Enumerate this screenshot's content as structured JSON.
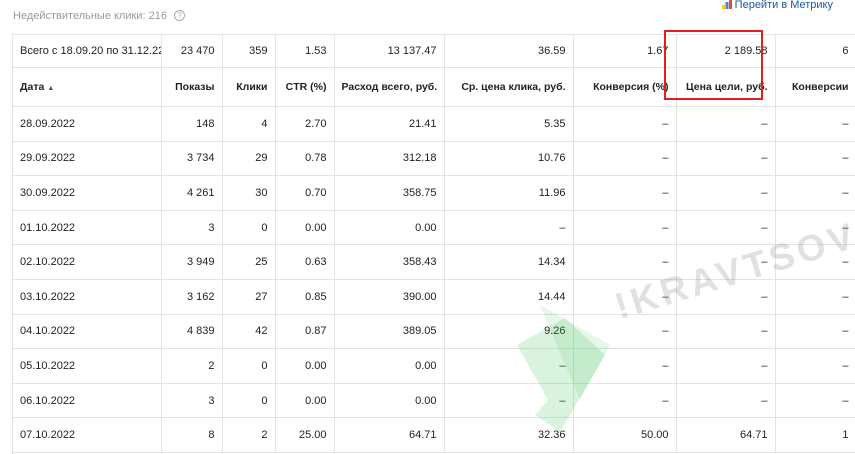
{
  "header": {
    "invalid_clicks_label": "Недействительные клики:",
    "invalid_clicks_value": "216",
    "help_icon": "question-circle-icon",
    "metrika_link": "Перейти в Метрику",
    "metrika_icon": "metrika-bars-icon"
  },
  "total": {
    "label": "Всего с 18.09.20 по 31.12.22",
    "cells": [
      "23 470",
      "359",
      "1.53",
      "13 137.47",
      "36.59",
      "1.67",
      "2 189.58",
      "6"
    ]
  },
  "columns": [
    "Дата",
    "Показы",
    "Клики",
    "CTR (%)",
    "Расход всего, руб.",
    "Ср. цена клика, руб.",
    "Конверсия (%)",
    "Цена цели, руб.",
    "Конверсии"
  ],
  "sort_indicator": "▲",
  "rows": [
    [
      "28.09.2022",
      "148",
      "4",
      "2.70",
      "21.41",
      "5.35",
      "–",
      "–",
      "–"
    ],
    [
      "29.09.2022",
      "3 734",
      "29",
      "0.78",
      "312.18",
      "10.76",
      "–",
      "–",
      "–"
    ],
    [
      "30.09.2022",
      "4 261",
      "30",
      "0.70",
      "358.75",
      "11.96",
      "–",
      "–",
      "–"
    ],
    [
      "01.10.2022",
      "3",
      "0",
      "0.00",
      "0.00",
      "–",
      "–",
      "–",
      "–"
    ],
    [
      "02.10.2022",
      "3 949",
      "25",
      "0.63",
      "358.43",
      "14.34",
      "–",
      "–",
      "–"
    ],
    [
      "03.10.2022",
      "3 162",
      "27",
      "0.85",
      "390.00",
      "14.44",
      "–",
      "–",
      "–"
    ],
    [
      "04.10.2022",
      "4 839",
      "42",
      "0.87",
      "389.05",
      "9.26",
      "–",
      "–",
      "–"
    ],
    [
      "05.10.2022",
      "2",
      "0",
      "0.00",
      "0.00",
      "–",
      "–",
      "–",
      "–"
    ],
    [
      "06.10.2022",
      "3",
      "0",
      "0.00",
      "0.00",
      "–",
      "–",
      "–",
      "–"
    ],
    [
      "07.10.2022",
      "8",
      "2",
      "25.00",
      "64.71",
      "32.36",
      "50.00",
      "64.71",
      "1"
    ]
  ],
  "watermark": "!KRAVTSOV",
  "colors": {
    "highlight_border": "#e41e1e",
    "link": "#1a5aa6",
    "watermark_green": "#2fbf4a"
  }
}
